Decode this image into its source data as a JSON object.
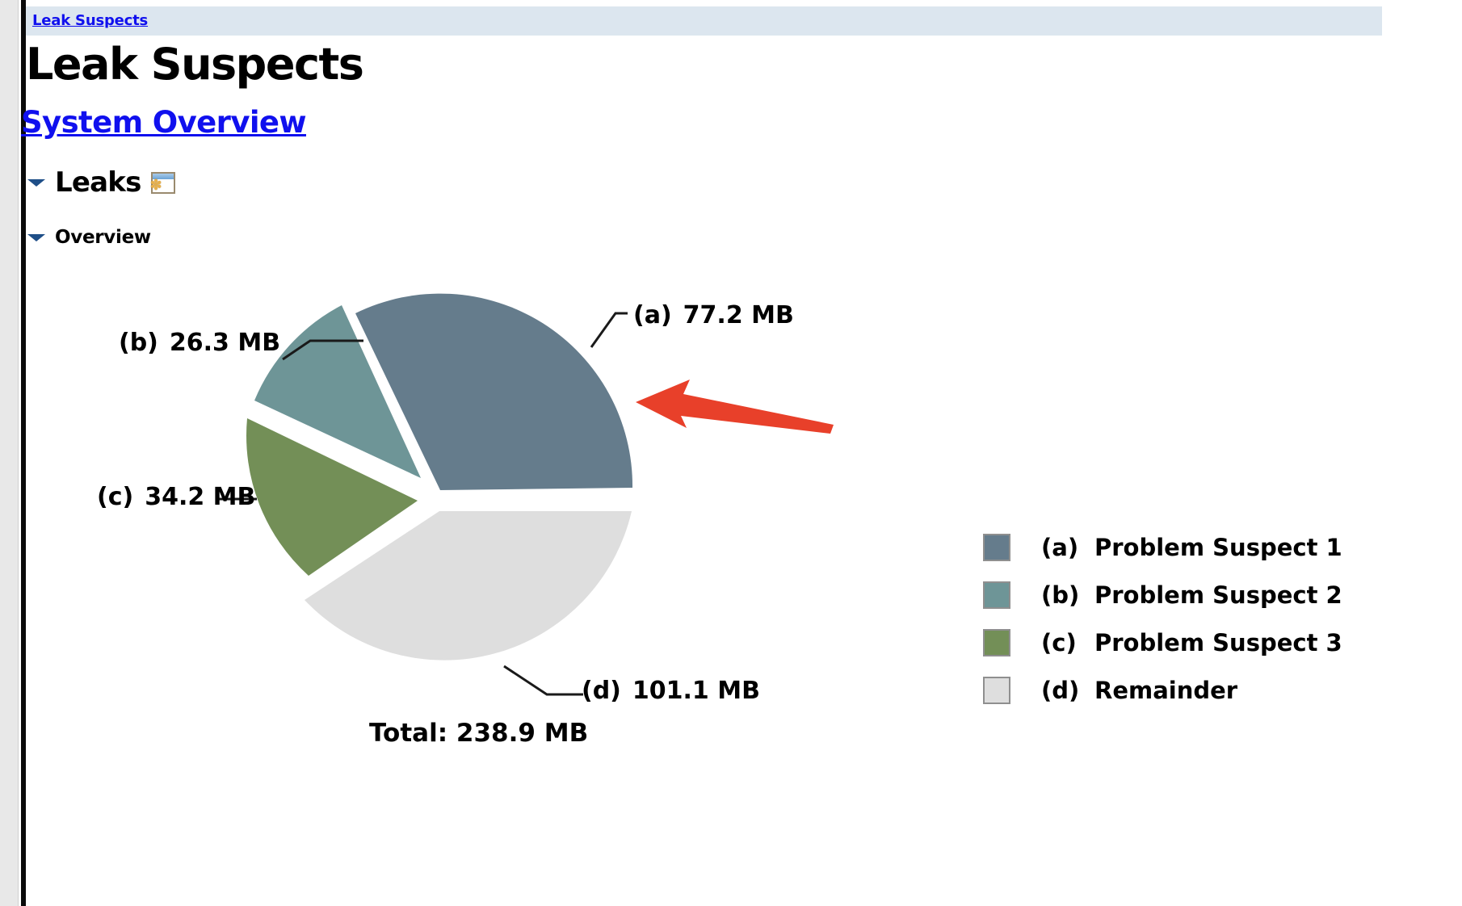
{
  "window": {
    "breadcrumb_label": "Leak Suspects",
    "page_title": "Leak Suspects",
    "system_overview_label": "System Overview"
  },
  "sections": {
    "leaks": {
      "label": "Leaks",
      "icon": "window-panel-icon",
      "disclosure": "chevron-down-icon",
      "glyph": "✽"
    },
    "overview": {
      "label": "Overview",
      "disclosure": "chevron-down-icon"
    }
  },
  "callouts": {
    "a": {
      "key": "(a)",
      "value": "77.2 MB"
    },
    "b": {
      "key": "(b)",
      "value": "26.3 MB"
    },
    "c": {
      "key": "(c)",
      "value": "34.2 MB"
    },
    "d": {
      "key": "(d)",
      "value": "101.1 MB"
    },
    "total": "Total: 238.9 MB"
  },
  "legend": {
    "rows": [
      {
        "key": "(a)",
        "label": "Problem Suspect 1",
        "color": "#657c8c"
      },
      {
        "key": "(b)",
        "label": "Problem Suspect 2",
        "color": "#6e9597"
      },
      {
        "key": "(c)",
        "label": "Problem Suspect 3",
        "color": "#738f57"
      },
      {
        "key": "(d)",
        "label": "Remainder",
        "color": "#dedede"
      }
    ]
  },
  "annotation": {
    "arrow_color": "#e8402a",
    "arrow_name": "red-pointer-arrow"
  },
  "colors": {
    "breadcrumb_bg": "#dce6ef",
    "link": "#1010ee",
    "gutter": "#e8e8e8",
    "rule": "#0a0a0a"
  },
  "chart_data": {
    "type": "pie",
    "title": "Leak Suspects Overview",
    "unit": "MB",
    "total": 238.9,
    "total_label": "Total: 238.9 MB",
    "categories": [
      "(a) Problem Suspect 1",
      "(b) Problem Suspect 2",
      "(c) Problem Suspect 3",
      "(d) Remainder"
    ],
    "keys": [
      "(a)",
      "(b)",
      "(c)",
      "(d)"
    ],
    "labels": [
      "77.2 MB",
      "26.3 MB",
      "34.2 MB",
      "101.1 MB"
    ],
    "values": [
      77.2,
      26.3,
      34.2,
      101.1
    ],
    "percentages": [
      32.3,
      11.0,
      14.3,
      42.3
    ],
    "colors": [
      "#657c8c",
      "#6e9597",
      "#738f57",
      "#dedede"
    ],
    "exploded": [
      true,
      true,
      true,
      true
    ],
    "start_angle_deg": 0,
    "direction": "counterclockwise",
    "legend_position": "right",
    "grid": false
  }
}
